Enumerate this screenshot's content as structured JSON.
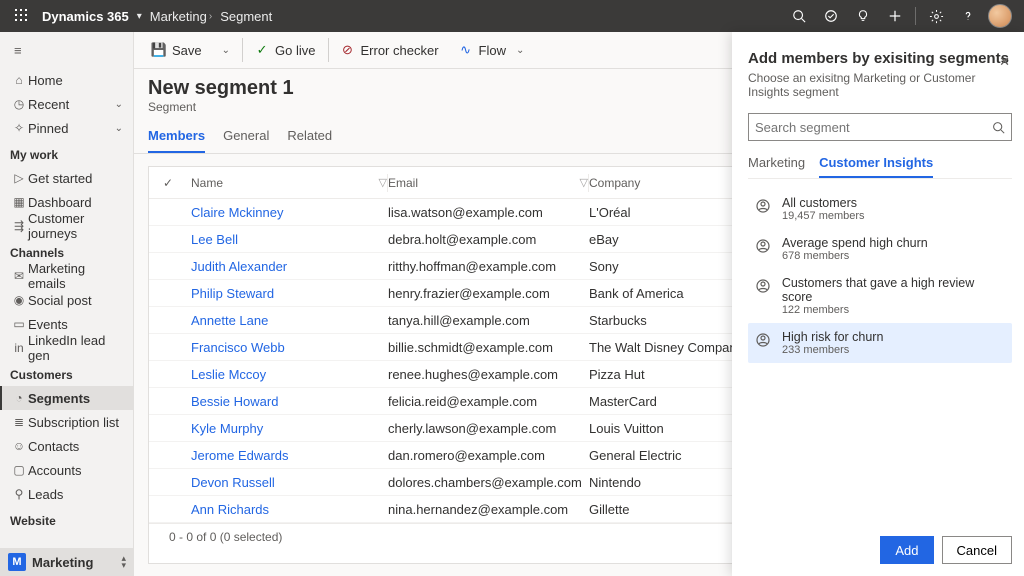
{
  "topbar": {
    "brand": "Dynamics 365",
    "crumb1": "Marketing",
    "crumb2": "Segment"
  },
  "sidebar": {
    "home": "Home",
    "recent": "Recent",
    "pinned": "Pinned",
    "sections": {
      "mywork": "My work",
      "channels": "Channels",
      "customers": "Customers",
      "website": "Website"
    },
    "mywork": [
      "Get started",
      "Dashboard",
      "Customer journeys"
    ],
    "channels": [
      "Marketing emails",
      "Social post",
      "Events",
      "LinkedIn lead gen"
    ],
    "customers": [
      "Segments",
      "Subscription list",
      "Contacts",
      "Accounts",
      "Leads"
    ],
    "area": "Marketing"
  },
  "commands": {
    "save": "Save",
    "golive": "Go live",
    "errorchecker": "Error checker",
    "flow": "Flow"
  },
  "header": {
    "title": "New segment 1",
    "subtitle": "Segment"
  },
  "tabs": [
    "Members",
    "General",
    "Related"
  ],
  "grid": {
    "columns": [
      "Name",
      "Email",
      "Company"
    ],
    "rows": [
      {
        "name": "Claire Mckinney",
        "email": "lisa.watson@example.com",
        "company": "L'Oréal"
      },
      {
        "name": "Lee Bell",
        "email": "debra.holt@example.com",
        "company": "eBay"
      },
      {
        "name": "Judith Alexander",
        "email": "ritthy.hoffman@example.com",
        "company": "Sony"
      },
      {
        "name": "Philip Steward",
        "email": "henry.frazier@example.com",
        "company": "Bank of America"
      },
      {
        "name": "Annette Lane",
        "email": "tanya.hill@example.com",
        "company": "Starbucks"
      },
      {
        "name": "Francisco Webb",
        "email": "billie.schmidt@example.com",
        "company": "The Walt Disney Company"
      },
      {
        "name": "Leslie Mccoy",
        "email": "renee.hughes@example.com",
        "company": "Pizza Hut"
      },
      {
        "name": "Bessie Howard",
        "email": "felicia.reid@example.com",
        "company": "MasterCard"
      },
      {
        "name": "Kyle Murphy",
        "email": "cherly.lawson@example.com",
        "company": "Louis Vuitton"
      },
      {
        "name": "Jerome Edwards",
        "email": "dan.romero@example.com",
        "company": "General Electric"
      },
      {
        "name": "Devon Russell",
        "email": "dolores.chambers@example.com",
        "company": "Nintendo"
      },
      {
        "name": "Ann Richards",
        "email": "nina.hernandez@example.com",
        "company": "Gillette"
      }
    ],
    "footer": "0 - 0 of 0 (0 selected)"
  },
  "panel": {
    "title": "Add members by exisiting segments",
    "desc": "Choose an exisitng Marketing or Customer Insights segment",
    "search_placeholder": "Search segment",
    "tabs": [
      "Marketing",
      "Customer Insights"
    ],
    "segments": [
      {
        "title": "All customers",
        "sub": "19,457 members"
      },
      {
        "title": "Average spend high churn",
        "sub": "678 members"
      },
      {
        "title": "Customers that gave a high review score",
        "sub": "122 members"
      },
      {
        "title": "High risk for churn",
        "sub": "233 members"
      }
    ],
    "add": "Add",
    "cancel": "Cancel"
  }
}
